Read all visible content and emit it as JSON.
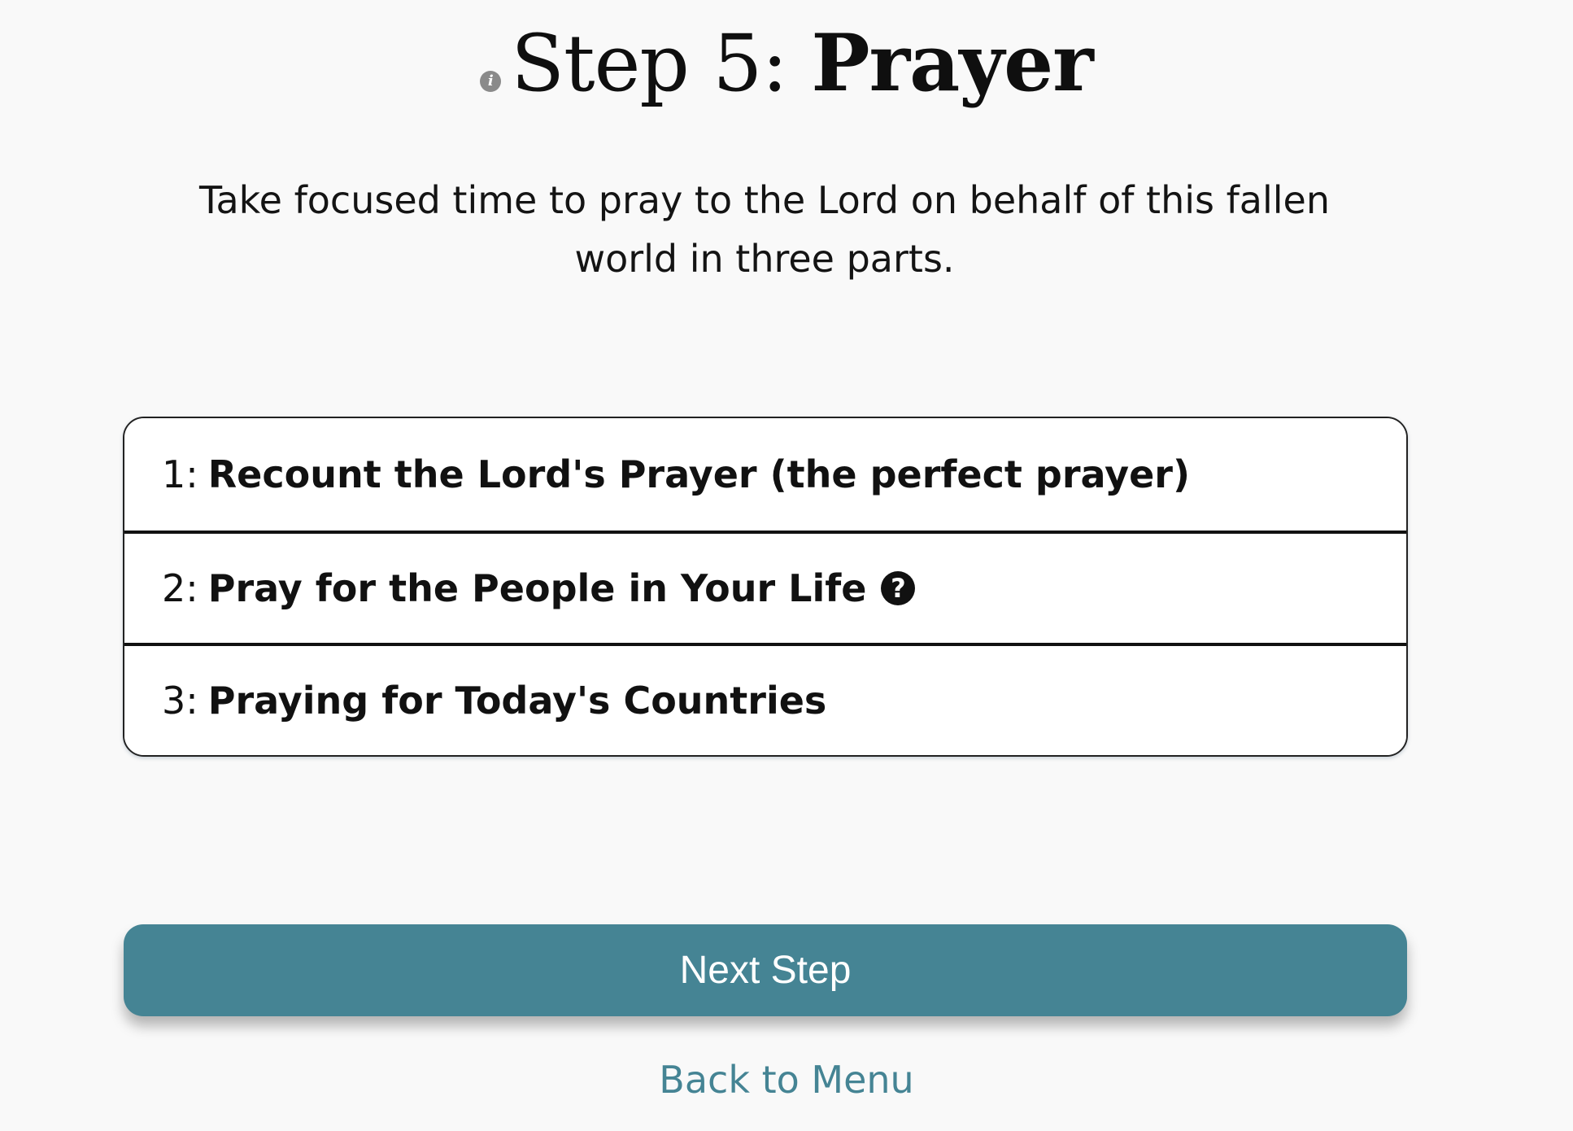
{
  "header": {
    "title_prefix": "Step 5:",
    "title_strong": "Prayer",
    "info_icon_glyph": "i"
  },
  "description": "Take focused time to pray to the Lord on behalf of this fallen world in three parts.",
  "parts": [
    {
      "number": "1:",
      "label": "Recount the Lord's Prayer (the perfect prayer)"
    },
    {
      "number": "2:",
      "label": "Pray for the People in Your Life",
      "help_icon": "?"
    },
    {
      "number": "3:",
      "label": "Praying for Today's Countries"
    }
  ],
  "actions": {
    "next_label": "Next Step",
    "back_label": "Back to Menu"
  },
  "colors": {
    "accent": "#458494",
    "background": "#f9f9f9",
    "text": "#111111"
  }
}
